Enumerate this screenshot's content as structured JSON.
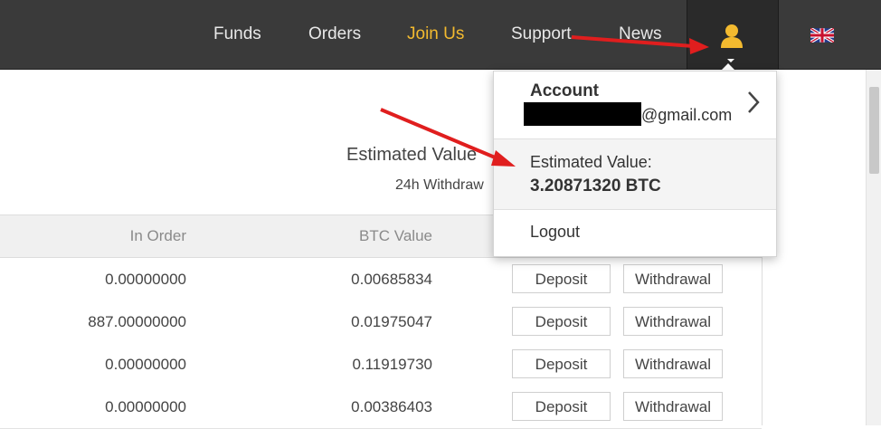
{
  "nav": {
    "items": [
      {
        "label": "Funds"
      },
      {
        "label": "Orders"
      },
      {
        "label": "Join Us"
      },
      {
        "label": "Support"
      },
      {
        "label": "News"
      }
    ],
    "user_icon": "user-icon",
    "language_icon": "uk-flag-icon"
  },
  "summary": {
    "estimated_title": "Estimated Value",
    "withdrawal_label": "24h Withdraw"
  },
  "table": {
    "columns": [
      "In Order",
      "BTC Value"
    ],
    "rows": [
      {
        "in_order": "0.00000000",
        "btc_value": "0.00685834",
        "deposit": "Deposit",
        "withdrawal": "Withdrawal"
      },
      {
        "in_order": "887.00000000",
        "btc_value": "0.01975047",
        "deposit": "Deposit",
        "withdrawal": "Withdrawal"
      },
      {
        "in_order": "0.00000000",
        "btc_value": "0.11919730",
        "deposit": "Deposit",
        "withdrawal": "Withdrawal"
      },
      {
        "in_order": "0.00000000",
        "btc_value": "0.00386403",
        "deposit": "Deposit",
        "withdrawal": "Withdrawal"
      }
    ]
  },
  "dropdown": {
    "account_title": "Account",
    "email_suffix": "@gmail.com",
    "estimated_label": "Estimated Value:",
    "estimated_value": "3.20871320 BTC",
    "logout": "Logout"
  },
  "colors": {
    "nav_bg": "#3a3a3a",
    "accent": "#f3ba2f",
    "annotation_arrow": "#e01e1e"
  }
}
